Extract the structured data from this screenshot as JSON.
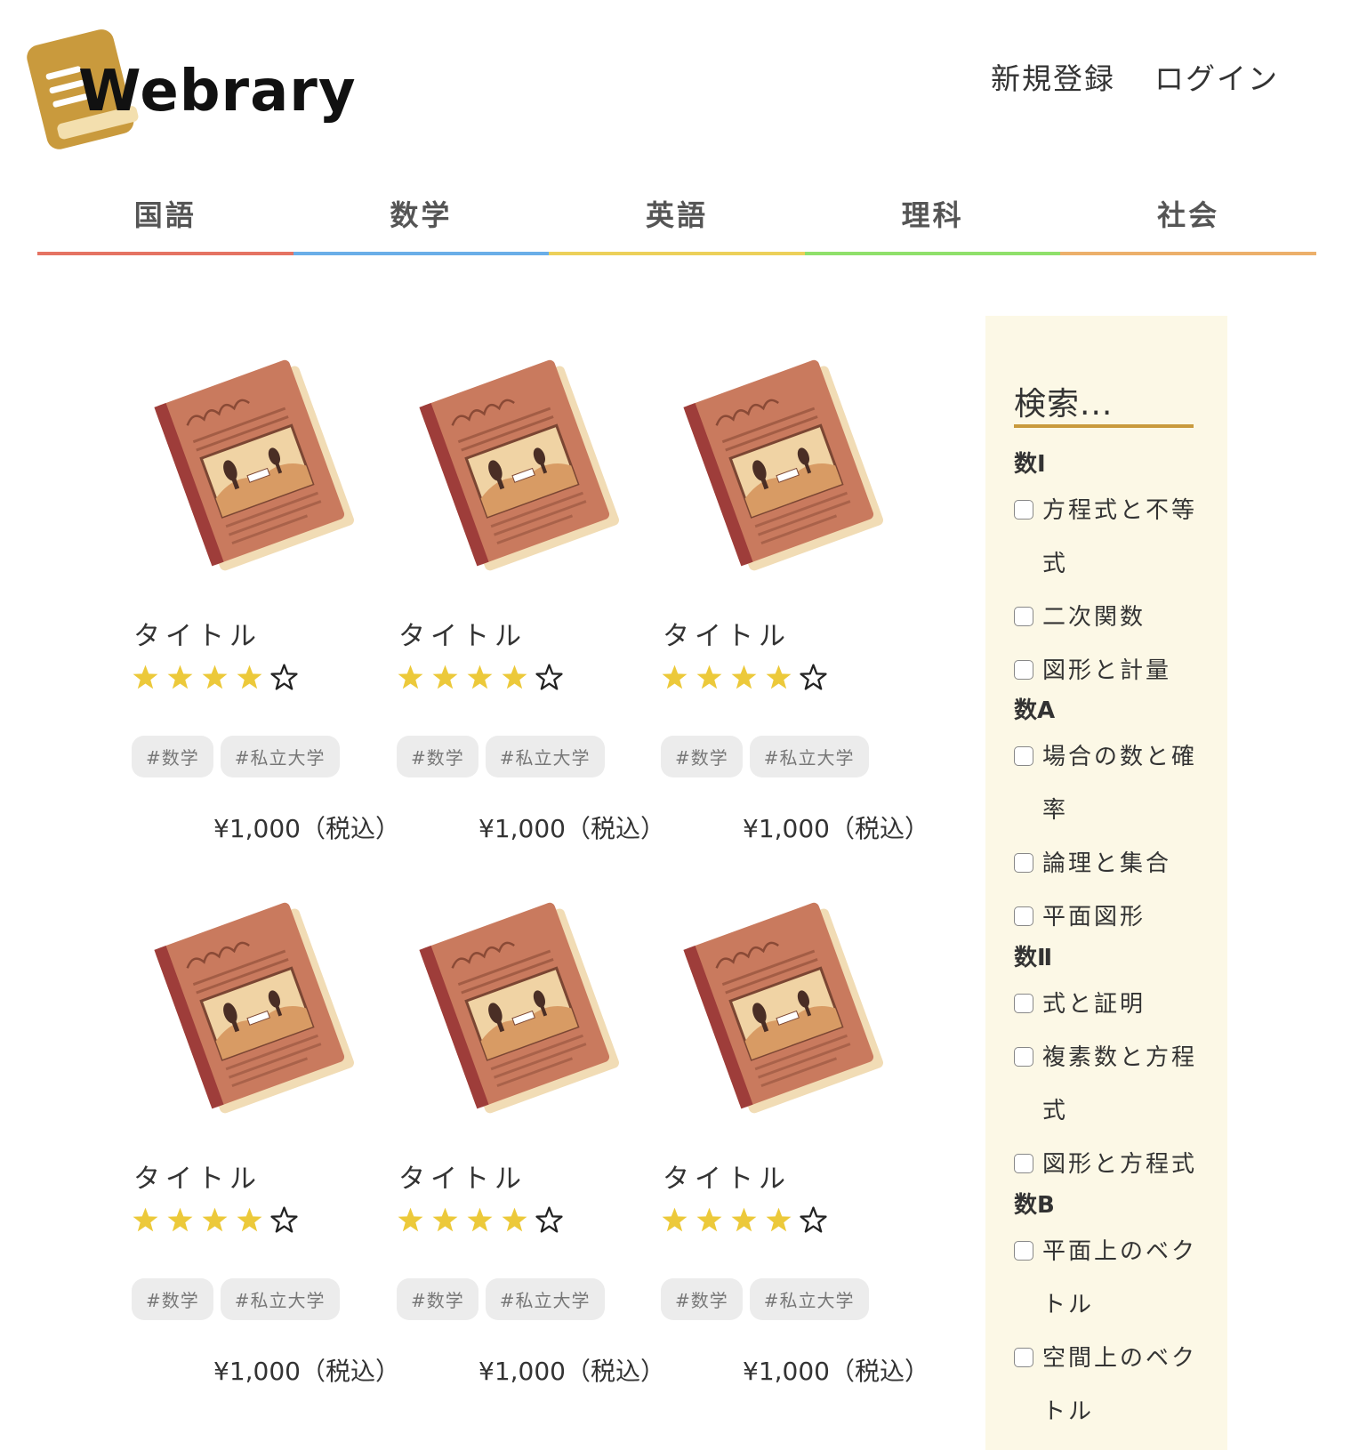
{
  "header": {
    "logo_text": "Webrary",
    "auth": {
      "signup": "新規登録",
      "login": "ログイン"
    }
  },
  "nav": {
    "tabs": [
      {
        "label": "国語",
        "color": "#e57363"
      },
      {
        "label": "数学",
        "color": "#6aaee8"
      },
      {
        "label": "英語",
        "color": "#ecd05a"
      },
      {
        "label": "理科",
        "color": "#8fe06b"
      },
      {
        "label": "社会",
        "color": "#ecb06b"
      }
    ]
  },
  "books": [
    {
      "title": "タイトル",
      "rating": 4,
      "max_rating": 5,
      "tags": [
        "#数学",
        "#私立大学"
      ],
      "price": "¥1,000（税込）"
    },
    {
      "title": "タイトル",
      "rating": 4,
      "max_rating": 5,
      "tags": [
        "#数学",
        "#私立大学"
      ],
      "price": "¥1,000（税込）"
    },
    {
      "title": "タイトル",
      "rating": 4,
      "max_rating": 5,
      "tags": [
        "#数学",
        "#私立大学"
      ],
      "price": "¥1,000（税込）"
    },
    {
      "title": "タイトル",
      "rating": 4,
      "max_rating": 5,
      "tags": [
        "#数学",
        "#私立大学"
      ],
      "price": "¥1,000（税込）"
    },
    {
      "title": "タイトル",
      "rating": 4,
      "max_rating": 5,
      "tags": [
        "#数学",
        "#私立大学"
      ],
      "price": "¥1,000（税込）"
    },
    {
      "title": "タイトル",
      "rating": 4,
      "max_rating": 5,
      "tags": [
        "#数学",
        "#私立大学"
      ],
      "price": "¥1,000（税込）"
    }
  ],
  "sidebar": {
    "search_placeholder": "検索...",
    "groups": [
      {
        "title": "数Ⅰ",
        "items": [
          "方程式と不等式",
          "二次関数",
          "図形と計量"
        ]
      },
      {
        "title": "数A",
        "items": [
          "場合の数と確率",
          "論理と集合",
          "平面図形"
        ]
      },
      {
        "title": "数Ⅱ",
        "items": [
          "式と証明",
          "複素数と方程式",
          "図形と方程式"
        ]
      },
      {
        "title": "数B",
        "items": [
          "平面上のベクトル",
          "空間上のベクトル"
        ]
      }
    ]
  },
  "colors": {
    "star": "#ecc93a",
    "sidebar_bg": "#fcf8e6",
    "search_underline": "#c99a3d",
    "logo": "#c99a3d"
  },
  "icons": {
    "logo": "book-logo-icon",
    "book": "book-cover-icon",
    "star_filled": "star-filled-icon",
    "star_empty": "star-outline-icon"
  }
}
